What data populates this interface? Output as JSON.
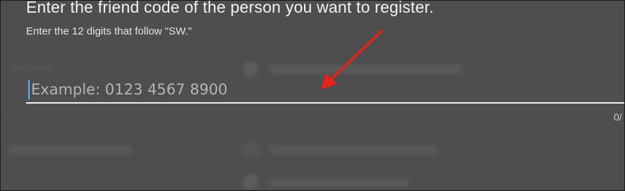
{
  "dialog": {
    "title": "Enter the friend code of the person you want to register.",
    "subtitle": "Enter the 12 digits that follow \"SW.\"",
    "input": {
      "value": "",
      "placeholder": "Example: 0123 4567 8900"
    },
    "char_count": "0/"
  },
  "annotation": {
    "arrow_color": "#e8211b"
  }
}
